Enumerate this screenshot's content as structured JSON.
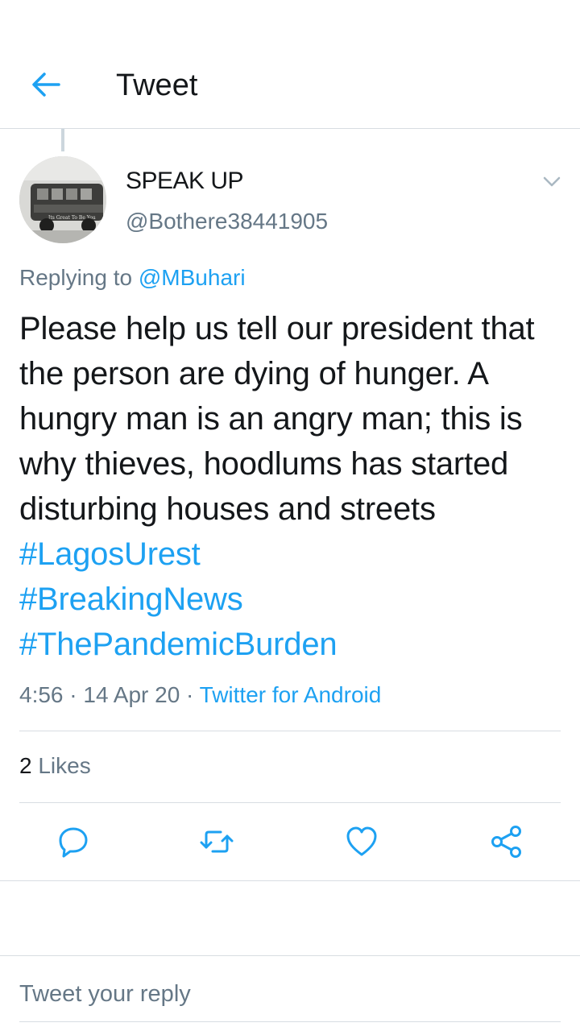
{
  "header": {
    "title": "Tweet",
    "back_icon": "arrow-left-icon"
  },
  "tweet": {
    "author": {
      "display_name": "SPEAK UP",
      "handle": "@Bothere38441905",
      "avatar_caption": "Its Great To Be You"
    },
    "replying_prefix": "Replying to ",
    "replying_to": "@MBuhari",
    "text_body": "Please help us tell our president that the person are dying of hunger. A hungry man is an angry man; this is why thieves, hoodlums has started disturbing houses and streets ",
    "hashtags": [
      "#LagosUrest",
      "#BreakingNews",
      "#ThePandemicBurden"
    ],
    "time": "4:56",
    "separator": " · ",
    "date": "14 Apr 20",
    "source": "Twitter for Android",
    "likes_count": "2",
    "likes_label": " Likes"
  },
  "actions": {
    "reply_icon": "reply-icon",
    "retweet_icon": "retweet-icon",
    "like_icon": "heart-icon",
    "share_icon": "share-icon"
  },
  "reply_box": {
    "placeholder": "Tweet your reply"
  },
  "colors": {
    "accent": "#1da1f2",
    "text_primary": "#14171a",
    "text_secondary": "#657786",
    "divider": "#d8dde2"
  }
}
